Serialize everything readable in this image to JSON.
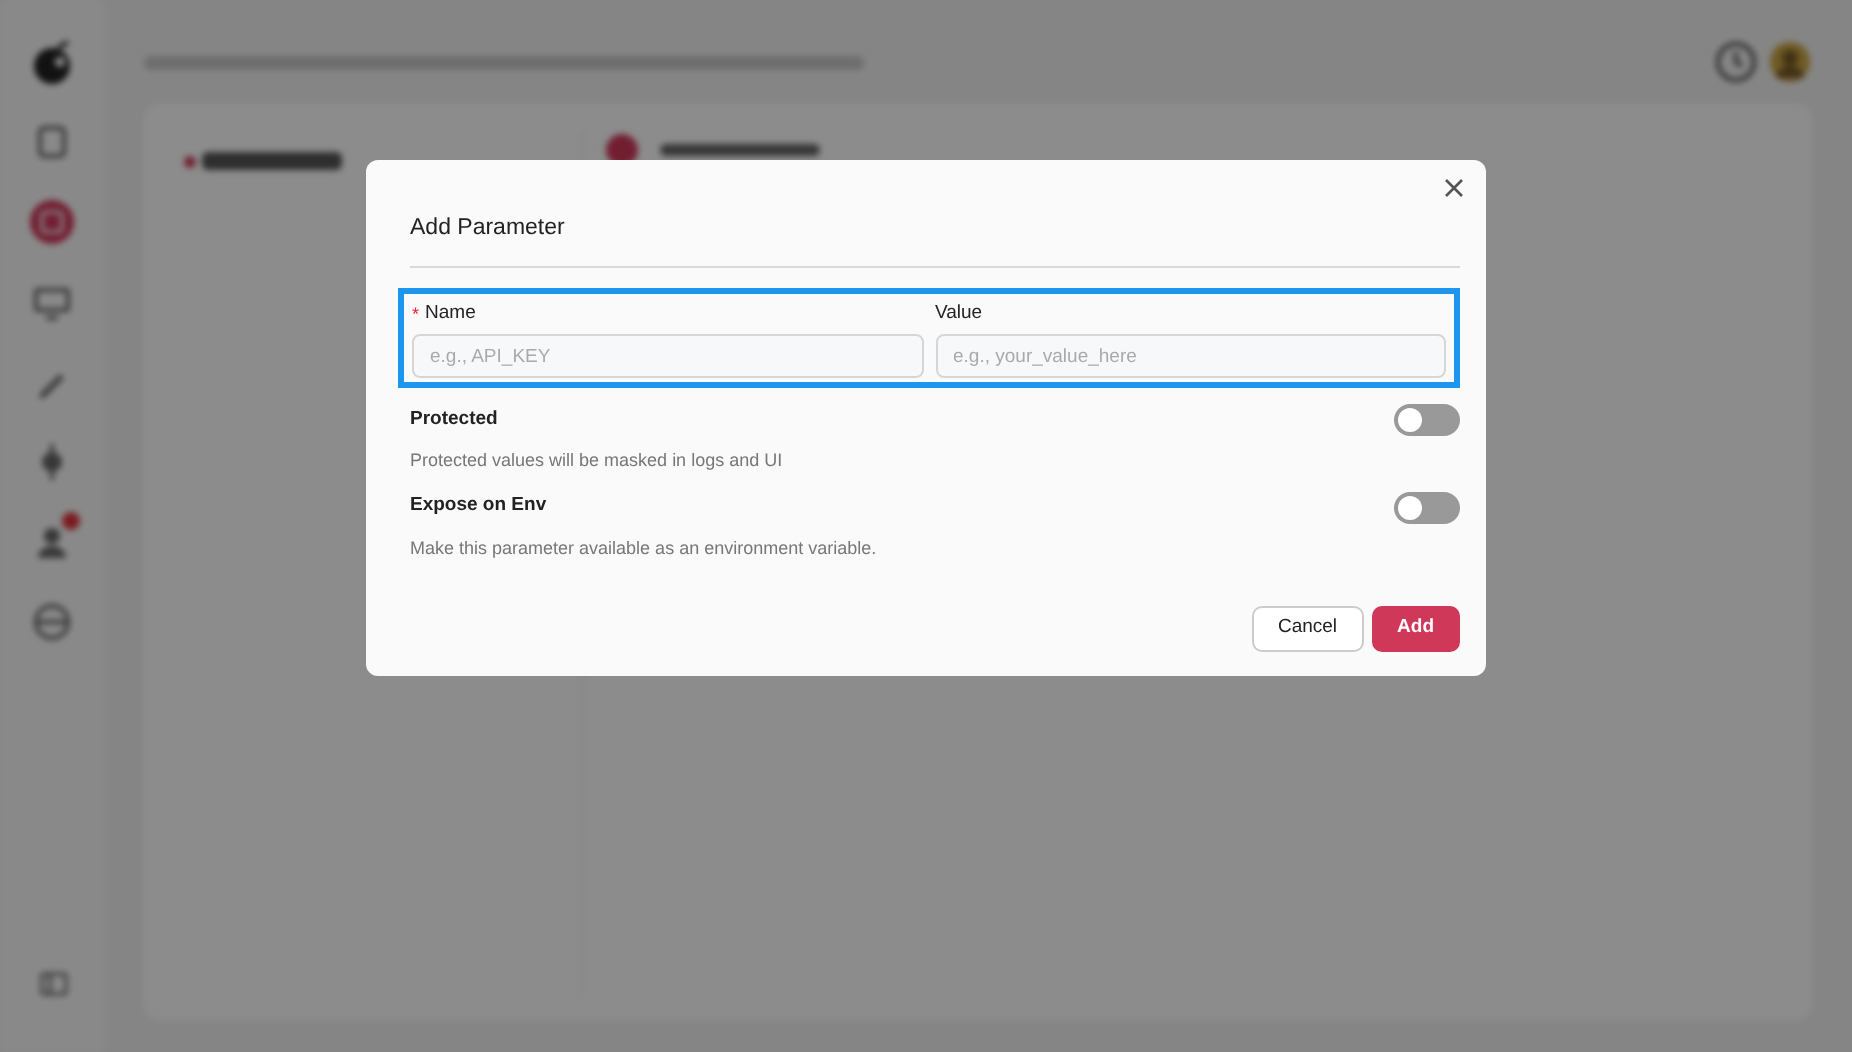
{
  "background": {
    "alert_badge": true
  },
  "dialog": {
    "title": "Add Parameter",
    "fields_highlighted": true,
    "fields": [
      {
        "label": "Name",
        "required_mark": "*",
        "placeholder": "e.g., API_KEY"
      },
      {
        "label": "Value",
        "placeholder": "e.g., your_value_here"
      }
    ],
    "toggles": [
      {
        "label": "Protected",
        "description": "Protected values will be masked in logs and UI",
        "on": false
      },
      {
        "label": "Expose on Env",
        "description": "Make this parameter available as an environment variable.",
        "on": false
      }
    ],
    "buttons": [
      {
        "label": "Cancel",
        "kind": "secondary"
      },
      {
        "label": "Add",
        "kind": "primary"
      }
    ]
  }
}
